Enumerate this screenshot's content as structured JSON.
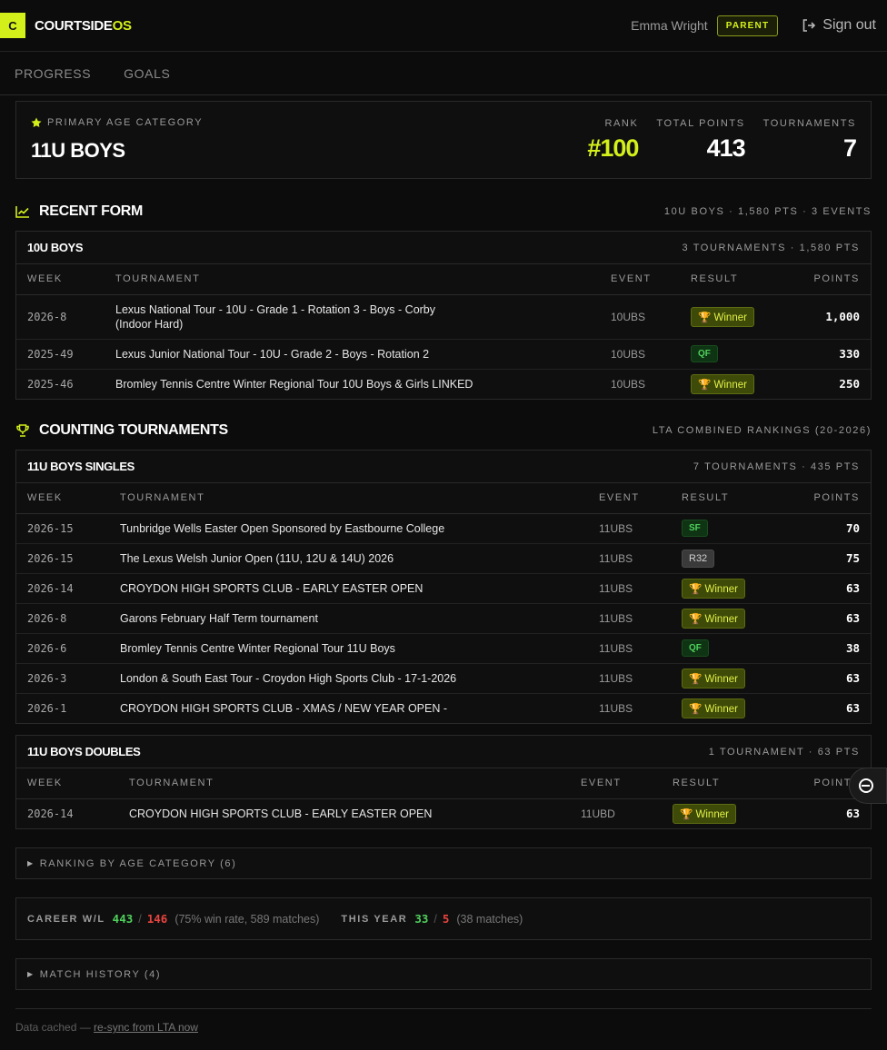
{
  "header": {
    "logo_letter": "C",
    "logo_main": "COURTSIDE",
    "logo_accent": "OS",
    "user_name": "Emma Wright",
    "role": "PARENT",
    "signout": "Sign out"
  },
  "tabs": [
    {
      "label": "PROGRESS"
    },
    {
      "label": "GOALS"
    }
  ],
  "summary": {
    "label": "PRIMARY AGE CATEGORY",
    "category": "11U BOYS",
    "stats": [
      {
        "label": "RANK",
        "value": "#100"
      },
      {
        "label": "TOTAL POINTS",
        "value": "413"
      },
      {
        "label": "TOURNAMENTS",
        "value": "7"
      }
    ]
  },
  "recent_form": {
    "title": "RECENT FORM",
    "meta": "10U BOYS · 1,580 PTS · 3 EVENTS",
    "card_title": "10U BOYS",
    "card_meta": "3 TOURNAMENTS · 1,580 PTS",
    "columns": [
      "WEEK",
      "TOURNAMENT",
      "EVENT",
      "RESULT",
      "POINTS"
    ],
    "rows": [
      {
        "week": "2026-8",
        "tournament": "Lexus National Tour - 10U - Grade 1 - Rotation 3 - Boys - Corby (Indoor Hard)",
        "event": "10UBS",
        "result": "🏆 Winner",
        "points": "1,000"
      },
      {
        "week": "2025-49",
        "tournament": "Lexus Junior National Tour - 10U - Grade 2 - Boys - Rotation 2",
        "event": "10UBS",
        "result": "QF",
        "points": "330"
      },
      {
        "week": "2025-46",
        "tournament": "Bromley Tennis Centre Winter Regional Tour 10U Boys & Girls LINKED",
        "event": "10UBS",
        "result": "🏆 Winner",
        "points": "250"
      }
    ]
  },
  "counting": {
    "title": "COUNTING TOURNAMENTS",
    "meta": "LTA COMBINED RANKINGS (20-2026)",
    "singles": {
      "card_title": "11U BOYS SINGLES",
      "card_meta": "7 TOURNAMENTS · 435 PTS",
      "columns": [
        "WEEK",
        "TOURNAMENT",
        "EVENT",
        "RESULT",
        "POINTS"
      ],
      "rows": [
        {
          "week": "2026-15",
          "tournament": "Tunbridge Wells Easter Open Sponsored by Eastbourne College",
          "event": "11UBS",
          "result": "SF",
          "points": "70"
        },
        {
          "week": "2026-15",
          "tournament": "The Lexus Welsh Junior Open (11U, 12U & 14U) 2026",
          "event": "11UBS",
          "result": "R32",
          "points": "75"
        },
        {
          "week": "2026-14",
          "tournament": "CROYDON HIGH SPORTS CLUB - EARLY EASTER OPEN",
          "event": "11UBS",
          "result": "🏆 Winner",
          "points": "63"
        },
        {
          "week": "2026-8",
          "tournament": "Garons February Half Term tournament",
          "event": "11UBS",
          "result": "🏆 Winner",
          "points": "63"
        },
        {
          "week": "2026-6",
          "tournament": "Bromley Tennis Centre Winter Regional Tour 11U Boys",
          "event": "11UBS",
          "result": "QF",
          "points": "38"
        },
        {
          "week": "2026-3",
          "tournament": "London & South East Tour - Croydon High Sports Club - 17-1-2026",
          "event": "11UBS",
          "result": "🏆 Winner",
          "points": "63"
        },
        {
          "week": "2026-1",
          "tournament": "CROYDON HIGH SPORTS CLUB - XMAS / NEW YEAR OPEN -",
          "event": "11UBS",
          "result": "🏆 Winner",
          "points": "63"
        }
      ]
    },
    "doubles": {
      "card_title": "11U BOYS DOUBLES",
      "card_meta": "1 TOURNAMENT · 63 PTS",
      "columns": [
        "WEEK",
        "TOURNAMENT",
        "EVENT",
        "RESULT",
        "POINTS"
      ],
      "rows": [
        {
          "week": "2026-14",
          "tournament": "CROYDON HIGH SPORTS CLUB - EARLY EASTER OPEN",
          "event": "11UBD",
          "result": "🏆 Winner",
          "points": "63"
        }
      ]
    }
  },
  "ranking_by_age": "RANKING BY AGE CATEGORY (6)",
  "career": {
    "label": "CAREER W/L",
    "wins": "443",
    "losses": "146",
    "detail": "(75% win rate, 589 matches)",
    "year_label": "THIS YEAR",
    "year_wins": "33",
    "year_losses": "5",
    "year_detail": "(38 matches)"
  },
  "match_history": "MATCH HISTORY (4)",
  "footer": {
    "text": "Data cached — ",
    "link": "re-sync from LTA now"
  },
  "colors": {
    "accent": "#d4f01a",
    "win": "#4fd15c",
    "loss": "#e8443f"
  }
}
